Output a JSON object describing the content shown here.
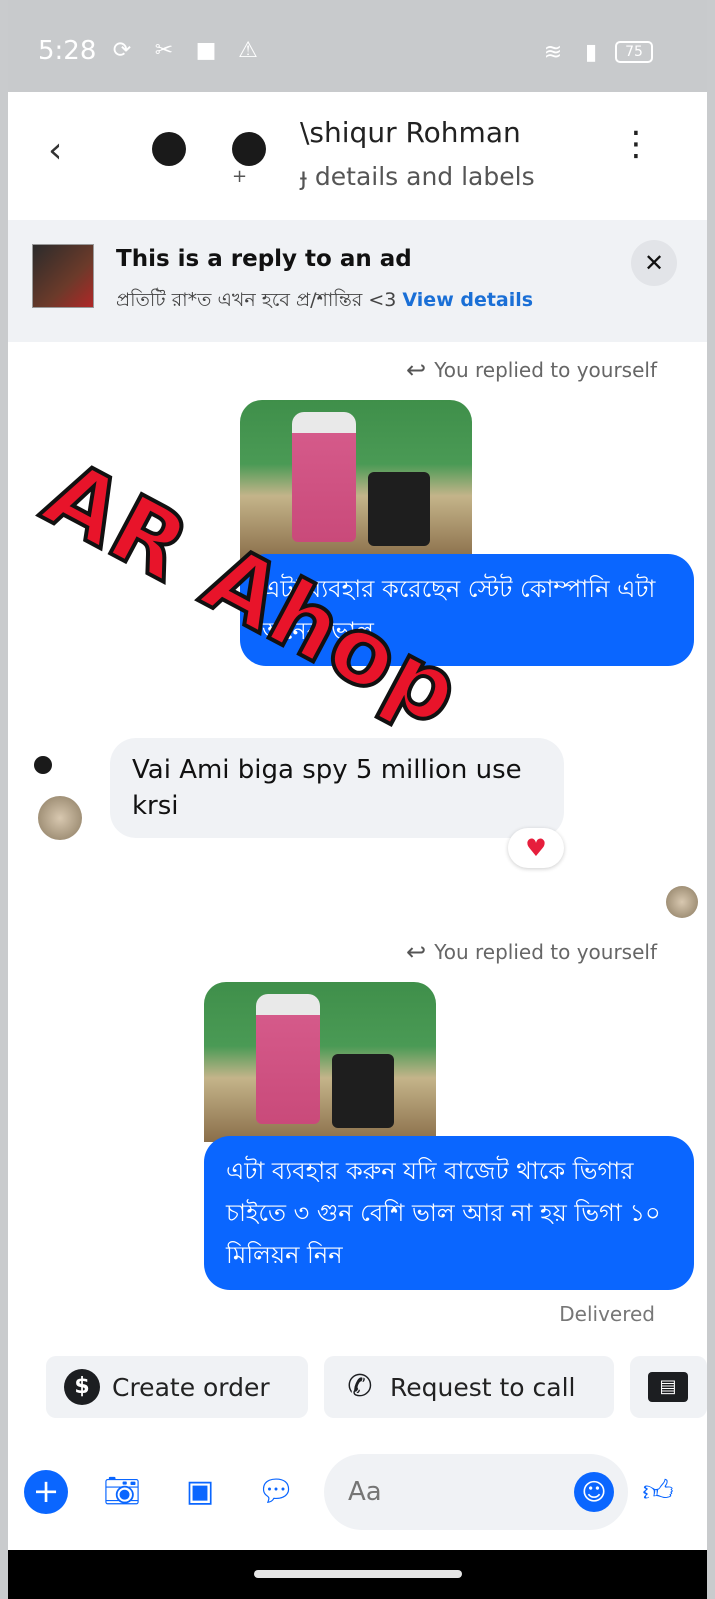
{
  "status": {
    "time": "5:28",
    "battery": "75"
  },
  "header": {
    "name": "\\shiqur Rohman",
    "subtitle": "ɟ details and labels",
    "plus": "+"
  },
  "ad": {
    "title": "This is a reply to an ad",
    "text": "প্রতিটি রা*ত এখন হবে প্র/শান্তির <3",
    "link": "View details"
  },
  "messages": {
    "reply_note_1": "You replied to yourself",
    "out_1": "এটা ব্যবহার করেছেন স্টেট কোম্পানি এটা অনেক ভাল",
    "in_1": "Vai Ami biga spy 5 million use krsi",
    "reply_note_2": "You replied to yourself",
    "out_2": "এটা ব্যবহার করুন যদি বাজেট থাকে ভিগার চাইতে ৩ গুন বেশি ভাল  আর না হয় ভিগা ১০ মিলিয়ন নিন",
    "delivered": "Delivered"
  },
  "watermark": "AR Ahop",
  "quick_actions": {
    "create_order": "Create order",
    "request_call": "Request to call"
  },
  "composer": {
    "placeholder": "Aa"
  },
  "colors": {
    "messenger_blue": "#0a66ff",
    "heart": "#e61e3c",
    "watermark_red": "#e8142a"
  }
}
